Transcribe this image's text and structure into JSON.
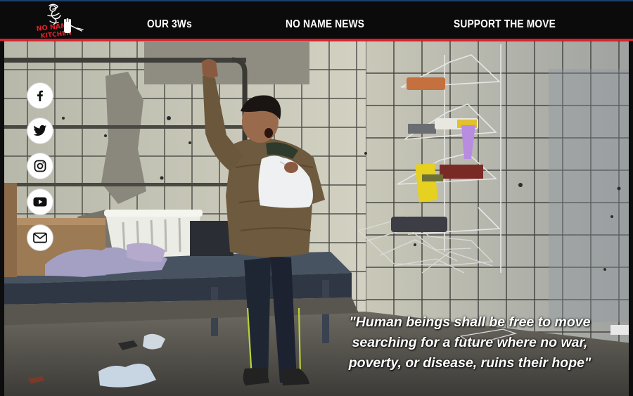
{
  "site": {
    "logo_text": "NO NAME KITCHEN"
  },
  "nav": {
    "items": [
      {
        "label": "OUR 3Ws"
      },
      {
        "label": "NO NAME NEWS"
      },
      {
        "label": "SUPPORT THE MOVE"
      }
    ]
  },
  "social": [
    {
      "name": "facebook-icon",
      "glyph": "f"
    },
    {
      "name": "twitter-icon",
      "glyph": "bird"
    },
    {
      "name": "instagram-icon",
      "glyph": "camera"
    },
    {
      "name": "youtube-icon",
      "glyph": "play"
    },
    {
      "name": "email-icon",
      "glyph": "envelope"
    }
  ],
  "hero": {
    "quote": "\"Human beings shall be free to move searching for a future where no war, poverty, or disease, ruins their hope\""
  },
  "colors": {
    "nav_bg": "#0b0b0b",
    "nav_accent": "#e0202b",
    "nav_text": "#ffffff",
    "logo_red": "#e0202b"
  }
}
